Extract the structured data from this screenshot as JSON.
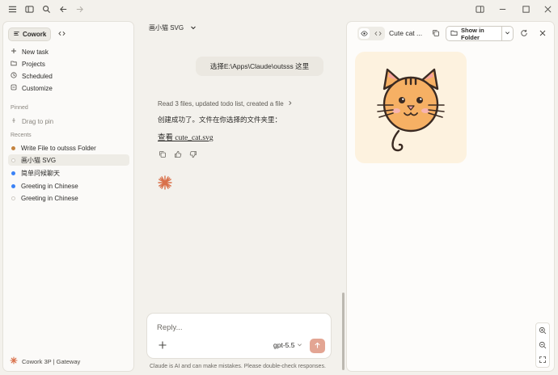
{
  "titlebar": {
    "icons": [
      "menu-icon",
      "sidebar-toggle-icon",
      "search-icon",
      "back-arrow-icon",
      "forward-arrow-icon",
      "split-view-icon",
      "minimize-icon",
      "maximize-icon",
      "close-icon"
    ]
  },
  "sidebar": {
    "tabs": [
      {
        "label": "Cowork",
        "icon": "cowork-icon",
        "active": true
      },
      {
        "label": "",
        "icon": "code-icon",
        "active": false
      }
    ],
    "nav": [
      {
        "label": "New task",
        "icon": "plus-icon"
      },
      {
        "label": "Projects",
        "icon": "folder-icon"
      },
      {
        "label": "Scheduled",
        "icon": "clock-icon"
      },
      {
        "label": "Customize",
        "icon": "customize-icon"
      }
    ],
    "pinned_heading": "Pinned",
    "pinned_placeholder": "Drag to pin",
    "recents_heading": "Recents",
    "recents": [
      {
        "label": "Write File to outsss Folder",
        "dot_color": "#c4833f",
        "selected": false
      },
      {
        "label": "画小猫 SVG",
        "dot_color": "#d9d6cf",
        "selected": true
      },
      {
        "label": "简单问候聊天",
        "dot_color": "#3b82f6",
        "selected": false
      },
      {
        "label": "Greeting in Chinese",
        "dot_color": "#3b82f6",
        "selected": false
      },
      {
        "label": "Greeting in Chinese",
        "dot_color": "#d9d6cf",
        "selected": false
      }
    ],
    "footer": "Cowork 3P | Gateway"
  },
  "chat": {
    "title": "画小猫 SVG",
    "user_message": "选择E:\\Apps\\Claude\\outsss 这里",
    "tool_summary": "Read 3 files, updated todo list, created a file",
    "assistant_text": "创建成功了。文件在你选择的文件夹里：",
    "file_link": "查看 cute_cat.svg",
    "composer": {
      "placeholder": "Reply...",
      "model": "gpt-5.5"
    },
    "disclaimer": "Claude is AI and can make mistakes. Please double-check responses.",
    "accent": "#d9704a"
  },
  "preview": {
    "title": "Cute cat ...",
    "show_in_folder": "Show in Folder",
    "card_bg": "#fdf2df",
    "cat_fill": "#f6b064",
    "cat_stroke": "#3a2a22",
    "nose_color": "#f0a0a8",
    "cheek_color": "#f7b4b0"
  }
}
